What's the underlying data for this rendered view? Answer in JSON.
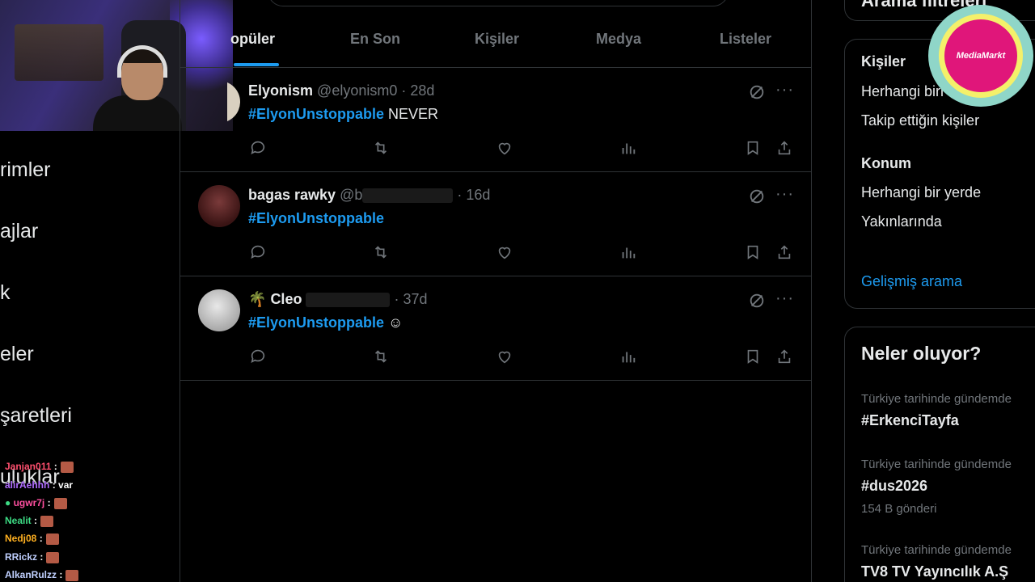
{
  "left_nav": {
    "items": [
      "rimler",
      "ajlar",
      "k",
      "eler",
      "şaretleri",
      "uluklar"
    ]
  },
  "chat": {
    "lines": [
      {
        "user": "Janjan011",
        "msg": ":",
        "color": "#ff4f6e"
      },
      {
        "user": "alirAehhh",
        "msg": ": var",
        "color": "#b06cff"
      },
      {
        "user": "ugwr7j",
        "msg": ":",
        "color": "#ff4fa0"
      },
      {
        "user": "Nealit",
        "msg": ":",
        "color": "#3ddc84"
      },
      {
        "user": "Nedj08",
        "msg": ":",
        "color": "#ffb020"
      },
      {
        "user": "RRickz",
        "msg": ":",
        "color": "#c0d0ff"
      },
      {
        "user": "AlkanRulzz",
        "msg": ":",
        "color": "#c0d0ff"
      }
    ]
  },
  "tabs": [
    "opüler",
    "En Son",
    "Kişiler",
    "Medya",
    "Listeler"
  ],
  "tweets": [
    {
      "name": "Elyonism",
      "handle": "@elyonism0",
      "time": "· 28d",
      "hashtag": "#ElyonUnstoppable",
      "text": " NEVER"
    },
    {
      "name": "bagas rawky",
      "handle": "@b",
      "time": "· 16d",
      "hashtag": "#ElyonUnstoppable",
      "text": ""
    },
    {
      "name": "Cleo",
      "prefix": "🌴",
      "handle": "",
      "time": "· 37d",
      "hashtag": "#ElyonUnstoppable",
      "text": " ☺"
    }
  ],
  "search_filters": {
    "title_partial": "Arama filtreleri",
    "people_heading": "Kişiler",
    "people_options": [
      "Herhangi biri",
      "Takip ettiğin kişiler"
    ],
    "location_heading": "Konum",
    "location_options": [
      "Herhangi bir yerde",
      "Yakınlarında"
    ],
    "advanced_link": "Gelişmiş arama"
  },
  "trends": {
    "heading": "Neler oluyor?",
    "items": [
      {
        "meta": "Türkiye tarihinde gündemde",
        "name": "#ErkenciTayfa",
        "count": ""
      },
      {
        "meta": "Türkiye tarihinde gündemde",
        "name": "#dus2026",
        "count": "154 B gönderi"
      },
      {
        "meta": "Türkiye tarihinde gündemde",
        "name": "TV8 TV Yayıncılık A.Ş",
        "count": ""
      }
    ]
  },
  "logo": {
    "text": "MediaMarkt"
  },
  "colors": {
    "accent": "#1d9bf0",
    "border": "#2f3336",
    "muted": "#71767b"
  }
}
